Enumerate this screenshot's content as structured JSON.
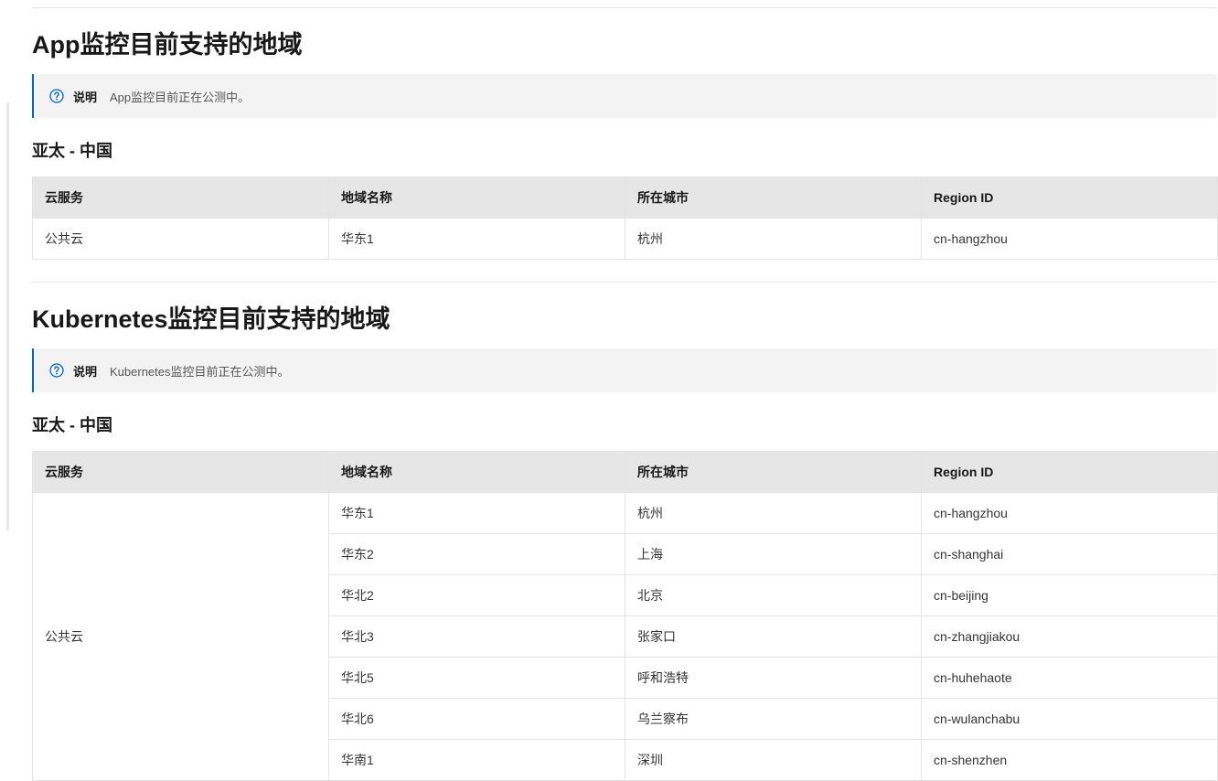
{
  "sections": [
    {
      "title": "App监控目前支持的地域",
      "note": {
        "label": "说明",
        "text": "App监控目前正在公测中。"
      },
      "subtitle": "亚太 - 中国",
      "table": {
        "headers": [
          "云服务",
          "地域名称",
          "所在城市",
          "Region ID"
        ],
        "service": "公共云",
        "rows": [
          {
            "region_name": "华东1",
            "city": "杭州",
            "region_id": "cn-hangzhou"
          }
        ]
      }
    },
    {
      "title": "Kubernetes监控目前支持的地域",
      "note": {
        "label": "说明",
        "text": "Kubernetes监控目前正在公测中。"
      },
      "subtitle": "亚太 - 中国",
      "table": {
        "headers": [
          "云服务",
          "地域名称",
          "所在城市",
          "Region ID"
        ],
        "service": "公共云",
        "rows": [
          {
            "region_name": "华东1",
            "city": "杭州",
            "region_id": "cn-hangzhou"
          },
          {
            "region_name": "华东2",
            "city": "上海",
            "region_id": "cn-shanghai"
          },
          {
            "region_name": "华北2",
            "city": "北京",
            "region_id": "cn-beijing"
          },
          {
            "region_name": "华北3",
            "city": "张家口",
            "region_id": "cn-zhangjiakou"
          },
          {
            "region_name": "华北5",
            "city": "呼和浩特",
            "region_id": "cn-huhehaote"
          },
          {
            "region_name": "华北6",
            "city": "乌兰察布",
            "region_id": "cn-wulanchabu"
          },
          {
            "region_name": "华南1",
            "city": "深圳",
            "region_id": "cn-shenzhen"
          }
        ]
      }
    }
  ],
  "colors": {
    "accent": "#0064c8",
    "note_bg": "#f3f3f3",
    "header_bg": "#e6e6e6",
    "border": "#e3e3e3"
  },
  "icons": {
    "note_icon": "question-circle-icon"
  }
}
